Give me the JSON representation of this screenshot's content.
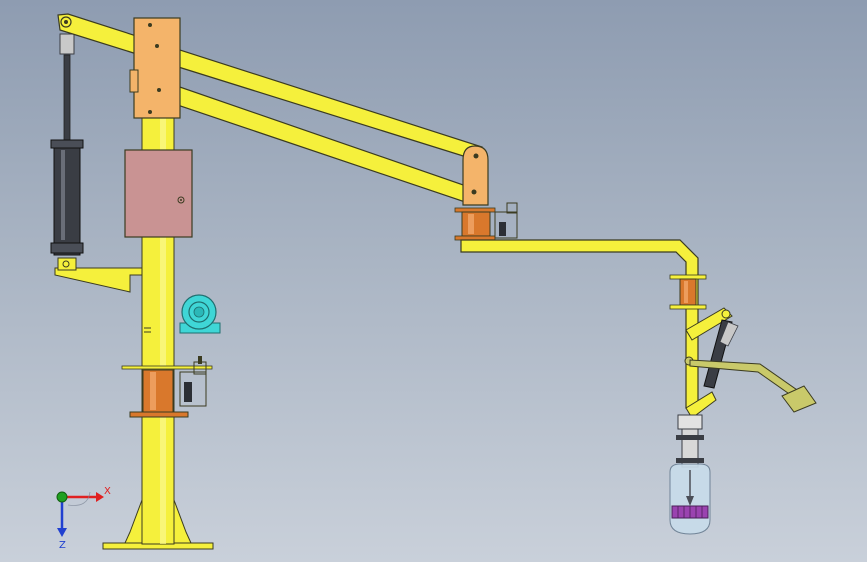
{
  "viewport": {
    "background_top": "#8e9cb1",
    "background_bottom": "#c9d0da"
  },
  "colors": {
    "yellow": "#f5f03c",
    "yellow_dark": "#b8b020",
    "orange_plate": "#f4b46a",
    "copper": "#d9782c",
    "cabinet": "#c99393",
    "motor": "#3fd6d6",
    "cylinder": "#3a3d44",
    "outline": "#3b3b20",
    "gripper_glass": "#c8dcea",
    "gripper_purple": "#9a43b0",
    "axis_x": "#e02020",
    "axis_y": "#20a020",
    "axis_z": "#2040d0"
  },
  "triad": {
    "x_label": "X",
    "z_label": "Z"
  },
  "components": {
    "column": "yellow-column",
    "base": "base-plate",
    "head_bracket": "head-bracket",
    "upper_arm": "upper-parallel-arm",
    "lower_arm": "lower-parallel-arm",
    "balance_cylinder": "balance-cylinder",
    "cabinet": "control-cabinet",
    "motor": "drive-motor",
    "elbow_joint": "elbow-joint",
    "forearm": "forearm",
    "wrist": "wrist-joint",
    "gripper": "end-gripper",
    "handle": "operator-handle"
  }
}
